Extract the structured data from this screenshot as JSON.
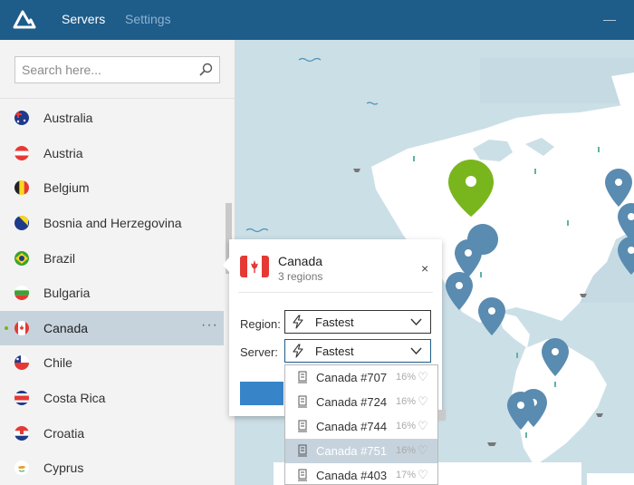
{
  "nav": {
    "tabs": [
      {
        "label": "Servers"
      },
      {
        "label": "Settings"
      }
    ],
    "minimize_symbol": "—"
  },
  "search": {
    "placeholder": "Search here...",
    "value": ""
  },
  "countries": [
    {
      "name": "Australia"
    },
    {
      "name": "Austria"
    },
    {
      "name": "Belgium"
    },
    {
      "name": "Bosnia and Herzegovina"
    },
    {
      "name": "Brazil"
    },
    {
      "name": "Bulgaria"
    },
    {
      "name": "Canada",
      "selected": true,
      "more": "···"
    },
    {
      "name": "Chile"
    },
    {
      "name": "Costa Rica"
    },
    {
      "name": "Croatia"
    },
    {
      "name": "Cyprus"
    }
  ],
  "popup": {
    "title": "Canada",
    "subtitle": "3 regions",
    "close": "×",
    "region_label": "Region:",
    "region_value": "Fastest",
    "server_label": "Server:",
    "server_value": "Fastest"
  },
  "server_list": [
    {
      "name": "Canada #707",
      "load": "16%",
      "heart": "♡"
    },
    {
      "name": "Canada #724",
      "load": "16%",
      "heart": "♡"
    },
    {
      "name": "Canada #744",
      "load": "16%",
      "heart": "♡"
    },
    {
      "name": "Canada #751",
      "load": "16%",
      "heart": "♡",
      "hover": true
    },
    {
      "name": "Canada #403",
      "load": "17%",
      "heart": "♡"
    }
  ],
  "colors": {
    "header": "#1e5c8a",
    "accent_green": "#79b61d",
    "pin_blue": "#5a8bb0",
    "map_water": "#cbdfe6",
    "map_land": "#ffffff",
    "selected_row": "#c6d3dd",
    "connect_button": "#3784c9"
  }
}
